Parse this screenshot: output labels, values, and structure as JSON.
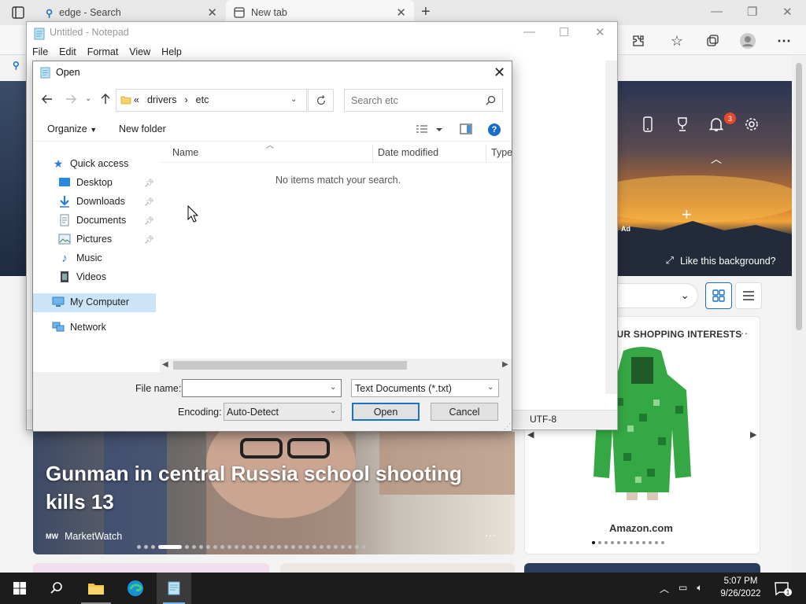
{
  "edge": {
    "tabs": [
      {
        "label": "edge - Search"
      },
      {
        "label": "New tab"
      }
    ],
    "newtab": {
      "notification_count": "3",
      "like_background": "Like this background?",
      "ad_label": "Ad",
      "shopping_title": "OUR SHOPPING INTERESTS",
      "shopping_store": "Amazon.com",
      "news_headline": "Gunman in central Russia school shooting kills 13",
      "news_source": "MarketWatch",
      "news_logo": "MW",
      "news_more": "···",
      "shopping_more": "···"
    }
  },
  "notepad": {
    "title": "Untitled - Notepad",
    "menu": [
      "File",
      "Edit",
      "Format",
      "View",
      "Help"
    ],
    "status_encoding": "UTF-8"
  },
  "dialog": {
    "title": "Open",
    "address_prefix": "«",
    "address_parts": [
      "drivers",
      "etc"
    ],
    "search_placeholder": "Search etc",
    "organize_label": "Organize",
    "new_folder_label": "New folder",
    "nav": {
      "quick_access": "Quick access",
      "desktop": "Desktop",
      "downloads": "Downloads",
      "documents": "Documents",
      "pictures": "Pictures",
      "music": "Music",
      "videos": "Videos",
      "my_computer": "My Computer",
      "network": "Network"
    },
    "columns": {
      "name": "Name",
      "date_modified": "Date modified",
      "type": "Type"
    },
    "empty_message": "No items match your search.",
    "file_name_label": "File name:",
    "file_name_value": "",
    "filter_value": "Text Documents (*.txt)",
    "encoding_label": "Encoding:",
    "encoding_value": "Auto-Detect",
    "open_label": "Open",
    "cancel_label": "Cancel"
  },
  "taskbar": {
    "time": "5:07 PM",
    "date": "9/26/2022",
    "notification_count": "1"
  },
  "colors": {
    "accent": "#1a73c8",
    "taskbar": "#1c1c1c",
    "selection": "#cce4f7",
    "badge": "#e34a2b"
  }
}
